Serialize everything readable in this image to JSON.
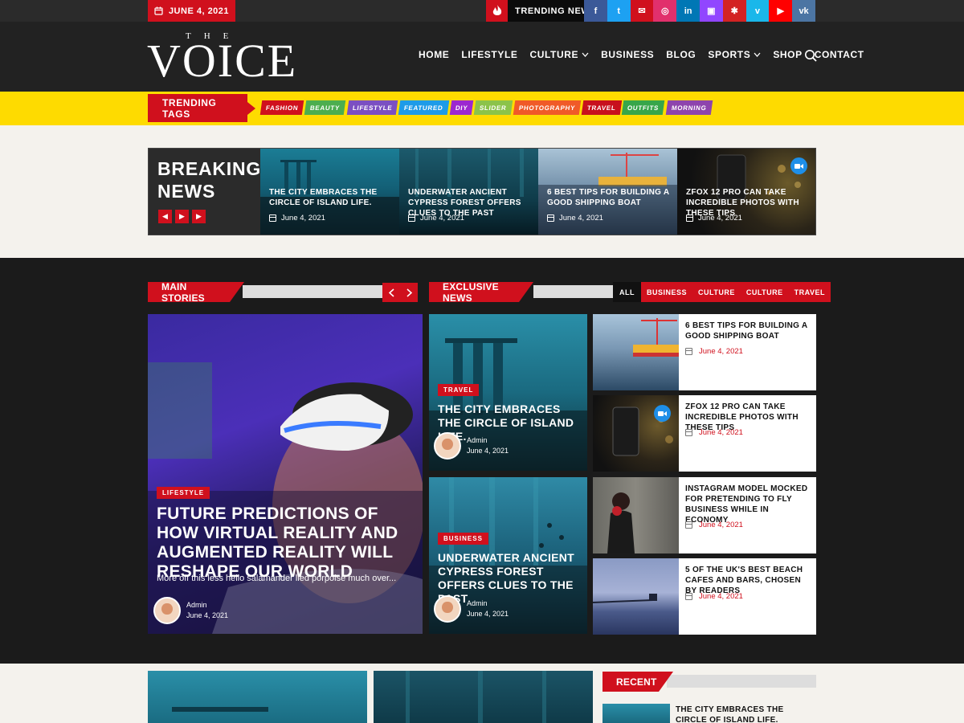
{
  "topbar": {
    "date": "JUNE 4, 2021",
    "trending_label": "TRENDING NEWS",
    "social": [
      {
        "icon": "facebook-icon",
        "glyph": "f",
        "color": "#3b5998"
      },
      {
        "icon": "twitter-icon",
        "glyph": "t",
        "color": "#1da1f2"
      },
      {
        "icon": "mail-icon",
        "glyph": "✉",
        "color": "#d0101d"
      },
      {
        "icon": "instagram-icon",
        "glyph": "◎",
        "color": "#e1306c"
      },
      {
        "icon": "linkedin-icon",
        "glyph": "in",
        "color": "#0077b5"
      },
      {
        "icon": "twitch-icon",
        "glyph": "▣",
        "color": "#9146ff"
      },
      {
        "icon": "yelp-icon",
        "glyph": "✱",
        "color": "#d32323"
      },
      {
        "icon": "vimeo-icon",
        "glyph": "v",
        "color": "#1ab7ea"
      },
      {
        "icon": "youtube-icon",
        "glyph": "▶",
        "color": "#ff0000"
      },
      {
        "icon": "vk-icon",
        "glyph": "vk",
        "color": "#4c75a3"
      }
    ]
  },
  "logo": {
    "the": "THE",
    "name": "VOICE"
  },
  "nav": {
    "items": [
      {
        "label": "HOME",
        "dropdown": false
      },
      {
        "label": "LIFESTYLE",
        "dropdown": false
      },
      {
        "label": "CULTURE",
        "dropdown": true
      },
      {
        "label": "BUSINESS",
        "dropdown": false
      },
      {
        "label": "BLOG",
        "dropdown": false
      },
      {
        "label": "SPORTS",
        "dropdown": true
      },
      {
        "label": "SHOP",
        "dropdown": false
      },
      {
        "label": "CONTACT",
        "dropdown": false
      }
    ]
  },
  "tags": {
    "label": "TRENDING TAGS",
    "items": [
      {
        "label": "FASHION",
        "color": "#d0101d"
      },
      {
        "label": "BEAUTY",
        "color": "#4cae4f"
      },
      {
        "label": "LIFESTYLE",
        "color": "#7b4fc2"
      },
      {
        "label": "FEATURED",
        "color": "#1e9be8"
      },
      {
        "label": "DIY",
        "color": "#9c27d0"
      },
      {
        "label": "SLIDER",
        "color": "#8bc34a"
      },
      {
        "label": "PHOTOGRAPHY",
        "color": "#f05a28"
      },
      {
        "label": "TRAVEL",
        "color": "#c8101d"
      },
      {
        "label": "OUTFITS",
        "color": "#37a64a"
      },
      {
        "label": "MORNING",
        "color": "#8e44ad"
      }
    ]
  },
  "breaking": {
    "title_line1": "BREAKING",
    "title_line2": "NEWS",
    "items": [
      {
        "title": "THE CITY EMBRACES THE CIRCLE OF ISLAND LIFE.",
        "date": "June 4, 2021"
      },
      {
        "title": "UNDERWATER ANCIENT CYPRESS FOREST OFFERS CLUES TO THE PAST",
        "date": "June 4, 2021"
      },
      {
        "title": "6 BEST TIPS FOR BUILDING A GOOD SHIPPING BOAT",
        "date": "June 4, 2021"
      },
      {
        "title": "ZFOX 12 PRO CAN TAKE INCREDIBLE PHOTOS WITH THESE TIPS",
        "date": "June 4, 2021"
      }
    ]
  },
  "main_stories": {
    "label": "MAIN STORIES",
    "featured": {
      "badge": "LIFESTYLE",
      "title": "FUTURE PREDICTIONS OF HOW VIRTUAL REALITY AND AUGMENTED REALITY WILL RESHAPE OUR WORLD",
      "excerpt": "More off this less hello salamander lied porpoise much over...",
      "author": "Admin",
      "date": "June 4, 2021"
    }
  },
  "exclusive": {
    "label": "EXCLUSIVE NEWS",
    "filters": [
      "ALL",
      "BUSINESS",
      "CULTURE",
      "CULTURE",
      "TRAVEL"
    ],
    "big": [
      {
        "badge": "TRAVEL",
        "title": "THE CITY EMBRACES THE CIRCLE OF ISLAND LIFE.",
        "author": "Admin",
        "date": "June 4, 2021"
      },
      {
        "badge": "BUSINESS",
        "title": "UNDERWATER ANCIENT CYPRESS FOREST OFFERS CLUES TO THE PAST",
        "author": "Admin",
        "date": "June 4, 2021"
      }
    ],
    "list": [
      {
        "title": "6 BEST TIPS FOR BUILDING A GOOD SHIPPING BOAT",
        "date": "June 4, 2021"
      },
      {
        "title": "ZFOX 12 PRO CAN TAKE INCREDIBLE PHOTOS WITH THESE TIPS",
        "date": "June 4, 2021"
      },
      {
        "title": "INSTAGRAM MODEL MOCKED FOR PRETENDING TO FLY BUSINESS WHILE IN ECONOMY",
        "date": "June 4, 2021"
      },
      {
        "title": "5 OF THE UK'S BEST BEACH CAFES AND BARS, CHOSEN BY READERS",
        "date": "June 4, 2021"
      }
    ]
  },
  "recent": {
    "label": "RECENT",
    "first_title": "THE CITY EMBRACES THE CIRCLE OF ISLAND LIFE."
  }
}
